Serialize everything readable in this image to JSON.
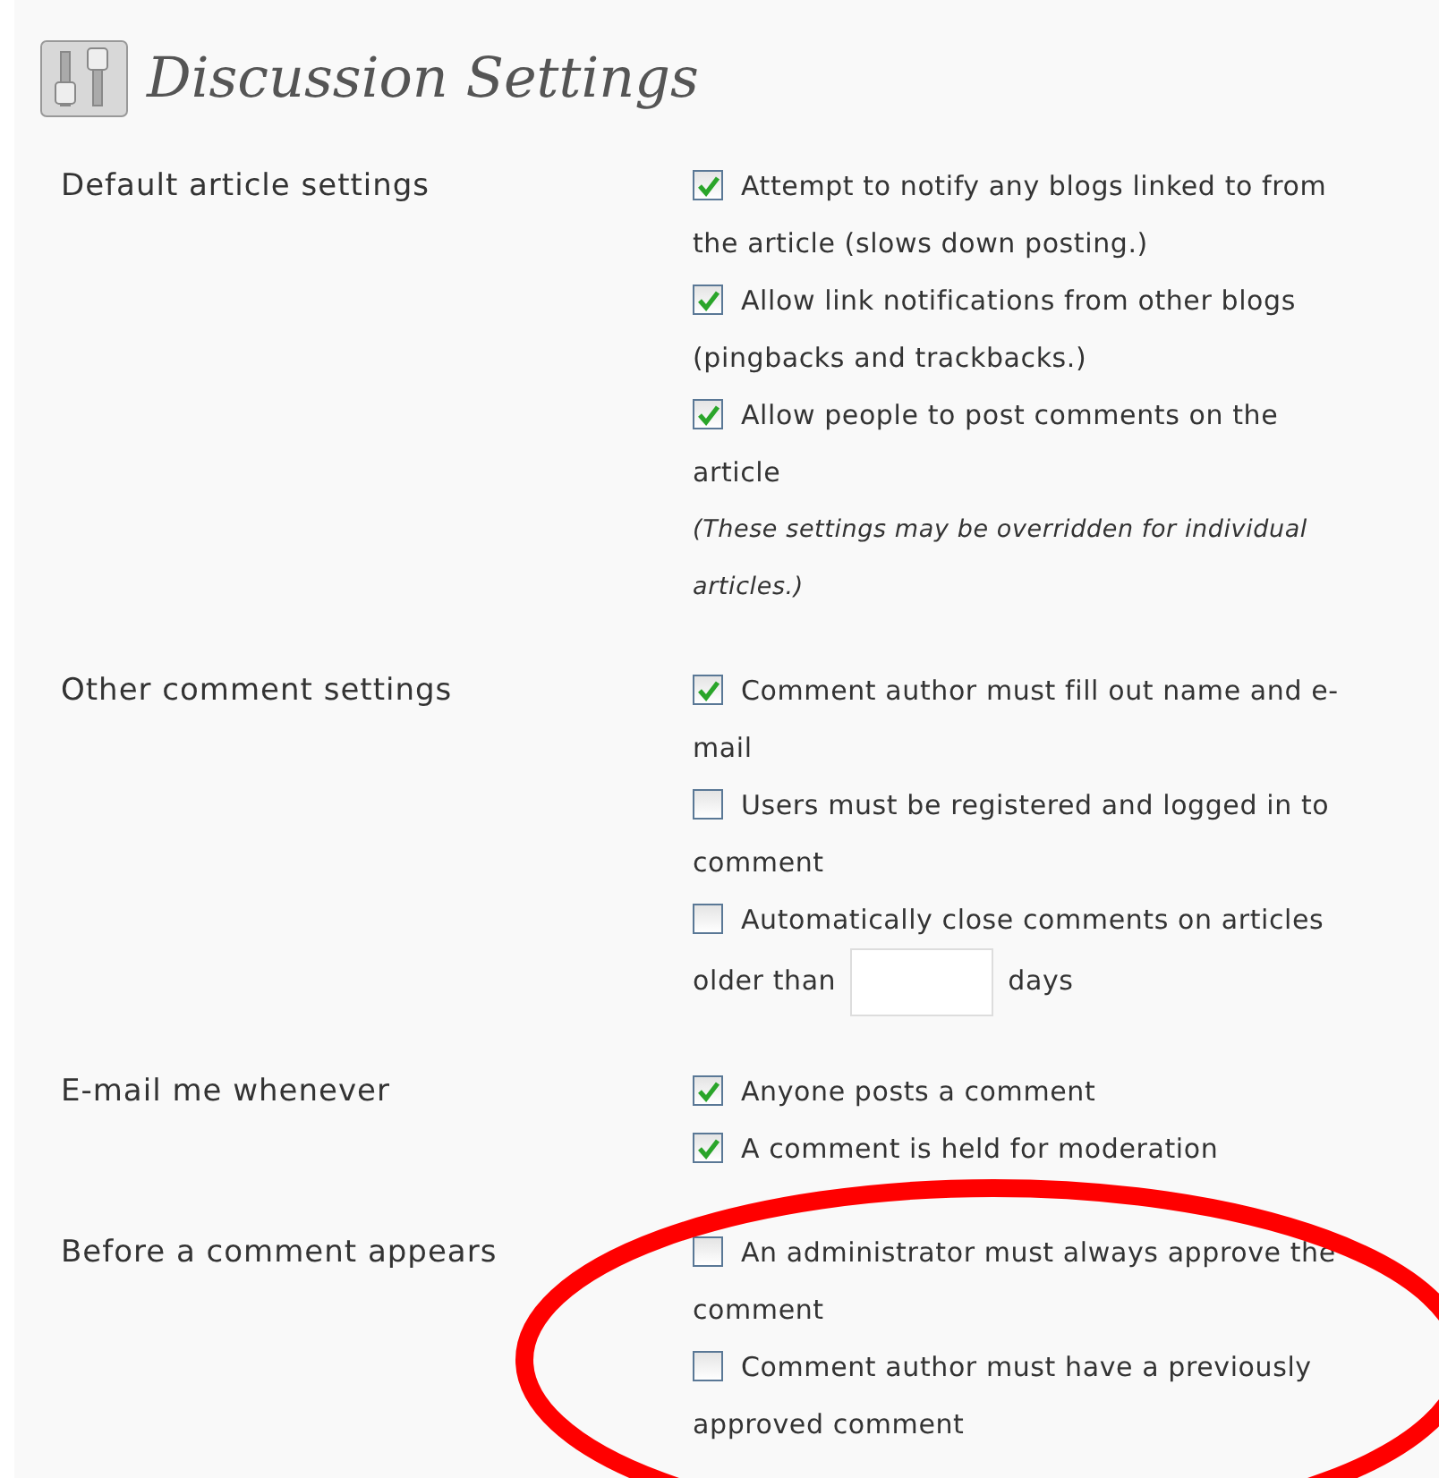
{
  "page": {
    "title": "Discussion Settings"
  },
  "sections": [
    {
      "label": "Default article settings",
      "options": [
        {
          "kind": "checkbox",
          "text": "Attempt to notify any blogs linked to from the article (slows down posting.)",
          "checked": true
        },
        {
          "kind": "checkbox",
          "text": "Allow link notifications from other blogs (pingbacks and trackbacks.)",
          "checked": true
        },
        {
          "kind": "checkbox",
          "text": "Allow people to post comments on the article",
          "checked": true
        },
        {
          "kind": "note",
          "text": "(These settings may be overridden for individual articles.)"
        }
      ]
    },
    {
      "label": "Other comment settings",
      "options": [
        {
          "kind": "checkbox",
          "text": "Comment author must fill out name and e-mail",
          "checked": true
        },
        {
          "kind": "checkbox",
          "text": "Users must be registered and logged in to comment",
          "checked": false
        },
        {
          "kind": "checkbox_field",
          "text": "Automatically close comments on articles older than",
          "suffix": "days",
          "checked": false
        }
      ]
    },
    {
      "label": "E-mail me whenever",
      "options": [
        {
          "kind": "checkbox",
          "text": "Anyone posts a comment",
          "checked": true
        },
        {
          "kind": "checkbox",
          "text": "A comment is held for moderation",
          "checked": true
        }
      ]
    },
    {
      "label": "Before a comment appears",
      "options": [
        {
          "kind": "checkbox",
          "text": "An administrator must always approve the comment",
          "checked": false
        },
        {
          "kind": "checkbox",
          "text": "Comment author must have a previously approved comment",
          "checked": false
        }
      ]
    }
  ]
}
